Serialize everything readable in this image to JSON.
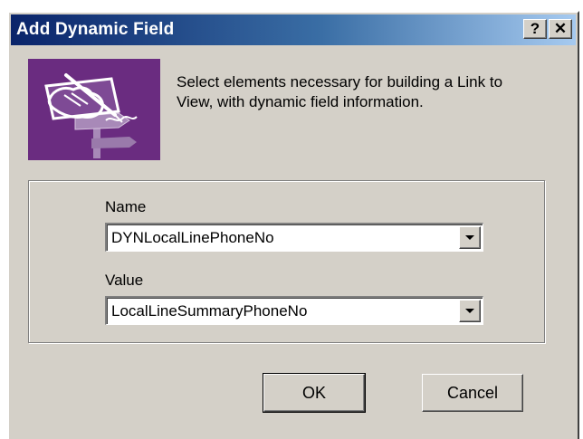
{
  "window": {
    "title": "Add Dynamic Field",
    "help_label": "?",
    "close_label": "✕"
  },
  "description": "Select elements necessary for building a Link to View, with dynamic field information.",
  "fields": {
    "name_label": "Name",
    "name_value": "DYNLocalLinePhoneNo",
    "value_label": "Value",
    "value_value": "LocalLineSummaryPhoneNo"
  },
  "buttons": {
    "ok": "OK",
    "cancel": "Cancel"
  },
  "colors": {
    "title_gradient_start": "#0a246a",
    "title_gradient_end": "#a6caf0",
    "dialog_face": "#d4d0c8",
    "icon_background": "#6a2c80"
  },
  "icons": {
    "dialog_icon": "hand-writing-signpost-icon",
    "dropdown": "chevron-down-icon"
  }
}
